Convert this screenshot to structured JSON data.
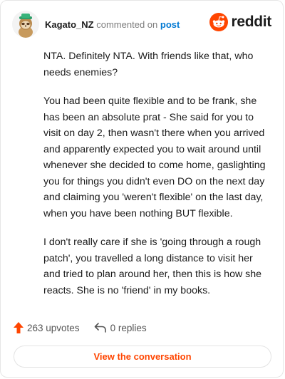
{
  "comment": {
    "username": "Kagato_NZ",
    "verb": "commented on",
    "target_link": "post",
    "paragraphs": [
      "NTA. Definitely NTA. With friends like that, who needs enemies?",
      "You had been quite flexible and to be frank, she has been an absolute prat - She said for you to visit on day 2, then wasn't there when you arrived and apparently expected you to wait around until whenever she decided to come home, gaslighting you for things you didn't even DO on the next day and claiming you 'weren't flexible' on the last day, when you have been nothing BUT flexible.",
      "I don't really care if she is 'going through a rough patch', you travelled a long distance to visit her and tried to plan around her, then this is how she reacts. She is no 'friend' in my books."
    ]
  },
  "brand": {
    "name": "reddit",
    "color": "#ff4500",
    "icon": "reddit-snoo-icon"
  },
  "stats": {
    "upvotes": "263 upvotes",
    "replies": "0 replies",
    "upvote_icon": "upvote-arrow-icon",
    "reply_icon": "reply-arrow-icon",
    "upvote_color": "#ff4500"
  },
  "cta": {
    "label": "View the conversation"
  }
}
